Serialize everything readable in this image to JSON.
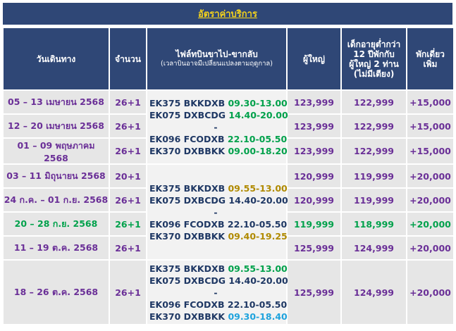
{
  "title": "อัตราค่าบริการ",
  "headers": {
    "date": "วันเดินทาง",
    "pax": "จำนวน",
    "flight_line1": "ไฟล์ทบินขาไป-ขากลับ",
    "flight_line2": "(เวลาบินอาจมีเปลี่ยนแปลงตามฤดูกาล)",
    "adult": "ผู้ใหญ่",
    "child_line1": "เด็กอายุต่ำกว่า",
    "child_line2": "12 ปีพักกับ",
    "child_line3": "ผู้ใหญ่ 2 ท่าน",
    "child_line4": "(ไม่มีเตียง)",
    "single_line1": "พักเดี่ยว",
    "single_line2": "เพิ่ม"
  },
  "rows": [
    {
      "date": "05 – 13 เมษายน 2568",
      "pax": "26+1",
      "adult": "123,999",
      "child": "122,999",
      "single": "+15,000"
    },
    {
      "date": "12 – 20 เมษายน 2568",
      "pax": "26+1",
      "adult": "123,999",
      "child": "122,999",
      "single": "+15,000"
    },
    {
      "date": "01 – 09 พฤษภาคม 2568",
      "pax": "26+1",
      "adult": "123,999",
      "child": "122,999",
      "single": "+15,000"
    },
    {
      "date": "03 – 11 มิถุนายน 2568",
      "pax": "20+1",
      "adult": "120,999",
      "child": "119,999",
      "single": "+20,000"
    },
    {
      "date": "24 ก.ค. – 01 ก.ย. 2568",
      "pax": "26+1",
      "adult": "120,999",
      "child": "119,999",
      "single": "+20,000"
    },
    {
      "date": "20 – 28 ก.ย. 2568",
      "pax": "26+1",
      "adult": "119,999",
      "child": "118,999",
      "single": "+20,000"
    },
    {
      "date": "11 – 19 ต.ค. 2568",
      "pax": "26+1",
      "adult": "125,999",
      "child": "124,999",
      "single": "+20,000"
    },
    {
      "date": "18 – 26 ต.ค. 2568",
      "pax": "26+1",
      "adult": "125,999",
      "child": "124,999",
      "single": "+20,000"
    }
  ],
  "flights": {
    "g1": {
      "l1_code": "EK375 BKKDXB",
      "l1_time": "09.30-13.00",
      "l2_code": "EK075 DXBCDG",
      "l2_time": "14.40-20.00",
      "dash": "-",
      "l3_code": "EK096 FCODXB",
      "l3_time": "22.10-05.50",
      "l4_code": "EK370 DXBBKK",
      "l4_time": "09.00-18.20"
    },
    "g2": {
      "l1_code": "EK375 BKKDXB",
      "l1_time": "09.55-13.00",
      "l2_code": "EK075 DXBCDG",
      "l2_time": "14.40-20.00",
      "dash": "-",
      "l3_code": "EK096 FCODXB",
      "l3_time": "22.10-05.50",
      "l4_code": "EK370 DXBBKK",
      "l4_time": "09.40-19.25"
    },
    "g3": {
      "l1_code": "EK375 BKKDXB",
      "l1_time": "09.55-13.00",
      "l2_code": "EK075 DXBCDG",
      "l2_time": "14.40-20.00",
      "dash": "-",
      "l3_code": "EK096 FCODXB",
      "l3_time": "22.10-05.50",
      "l4_code": "EK370 DXBBKK",
      "l4_time": "09.30-18.40"
    }
  },
  "colors": {
    "header_bg": "#2f4776",
    "title": "#f3d21c",
    "purple_text": "#6a2f97",
    "green_text": "#00a14b",
    "cell_bg": "#e6e6e6"
  }
}
